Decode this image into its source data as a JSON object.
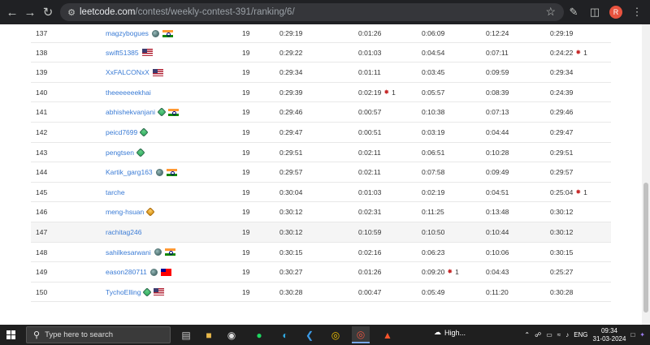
{
  "browser": {
    "url_host": "leetcode.com",
    "url_path": "/contest/weekly-contest-391/ranking/6/",
    "profile_initial": "R"
  },
  "ranking": [
    {
      "rank": "137",
      "user": "magzybogues",
      "badge": "guardian",
      "flag": "in",
      "score": "19",
      "finish": "0:29:19",
      "q1": "0:01:26",
      "q1_wrong": "",
      "q2": "0:06:09",
      "q2_wrong": "",
      "q3": "0:12:24",
      "q4": "0:29:19",
      "q4_wrong": ""
    },
    {
      "rank": "138",
      "user": "swift51385",
      "badge": "",
      "flag": "us",
      "score": "19",
      "finish": "0:29:22",
      "q1": "0:01:03",
      "q1_wrong": "",
      "q2": "0:04:54",
      "q2_wrong": "",
      "q3": "0:07:11",
      "q4": "0:24:22",
      "q4_wrong": "1"
    },
    {
      "rank": "139",
      "user": "XxFALCONxX",
      "badge": "",
      "flag": "us",
      "score": "19",
      "finish": "0:29:34",
      "q1": "0:01:11",
      "q1_wrong": "",
      "q2": "0:03:45",
      "q2_wrong": "",
      "q3": "0:09:59",
      "q4": "0:29:34",
      "q4_wrong": ""
    },
    {
      "rank": "140",
      "user": "theeeeeeekhai",
      "badge": "",
      "flag": "",
      "score": "19",
      "finish": "0:29:39",
      "q1": "0:02:19",
      "q1_wrong": "1",
      "q2": "0:05:57",
      "q2_wrong": "",
      "q3": "0:08:39",
      "q4": "0:24:39",
      "q4_wrong": ""
    },
    {
      "rank": "141",
      "user": "abhishekvanjani",
      "badge": "knight",
      "flag": "in",
      "score": "19",
      "finish": "0:29:46",
      "q1": "0:00:57",
      "q1_wrong": "",
      "q2": "0:10:38",
      "q2_wrong": "",
      "q3": "0:07:13",
      "q4": "0:29:46",
      "q4_wrong": ""
    },
    {
      "rank": "142",
      "user": "peicd7699",
      "badge": "knight",
      "flag": "",
      "score": "19",
      "finish": "0:29:47",
      "q1": "0:00:51",
      "q1_wrong": "",
      "q2": "0:03:19",
      "q2_wrong": "",
      "q3": "0:04:44",
      "q4": "0:29:47",
      "q4_wrong": ""
    },
    {
      "rank": "143",
      "user": "pengtsen",
      "badge": "knight",
      "flag": "",
      "score": "19",
      "finish": "0:29:51",
      "q1": "0:02:11",
      "q1_wrong": "",
      "q2": "0:06:51",
      "q2_wrong": "",
      "q3": "0:10:28",
      "q4": "0:29:51",
      "q4_wrong": ""
    },
    {
      "rank": "144",
      "user": "Kartik_garg163",
      "badge": "guardian",
      "flag": "in",
      "score": "19",
      "finish": "0:29:57",
      "q1": "0:02:11",
      "q1_wrong": "",
      "q2": "0:07:58",
      "q2_wrong": "",
      "q3": "0:09:49",
      "q4": "0:29:57",
      "q4_wrong": ""
    },
    {
      "rank": "145",
      "user": "tarche",
      "badge": "",
      "flag": "",
      "score": "19",
      "finish": "0:30:04",
      "q1": "0:01:03",
      "q1_wrong": "",
      "q2": "0:02:19",
      "q2_wrong": "",
      "q3": "0:04:51",
      "q4": "0:25:04",
      "q4_wrong": "1"
    },
    {
      "rank": "146",
      "user": "meng-hsuan",
      "badge": "gold",
      "flag": "",
      "score": "19",
      "finish": "0:30:12",
      "q1": "0:02:31",
      "q1_wrong": "",
      "q2": "0:11:25",
      "q2_wrong": "",
      "q3": "0:13:48",
      "q4": "0:30:12",
      "q4_wrong": ""
    },
    {
      "rank": "147",
      "user": "rachitag246",
      "badge": "",
      "flag": "",
      "score": "19",
      "finish": "0:30:12",
      "q1": "0:10:59",
      "q1_wrong": "",
      "q2": "0:10:50",
      "q2_wrong": "",
      "q3": "0:10:44",
      "q4": "0:30:12",
      "q4_wrong": ""
    },
    {
      "rank": "148",
      "user": "sahilkesarwani",
      "badge": "guardian",
      "flag": "in",
      "score": "19",
      "finish": "0:30:15",
      "q1": "0:02:16",
      "q1_wrong": "",
      "q2": "0:06:23",
      "q2_wrong": "",
      "q3": "0:10:06",
      "q4": "0:30:15",
      "q4_wrong": ""
    },
    {
      "rank": "149",
      "user": "eason280711",
      "badge": "guardian",
      "flag": "tw",
      "score": "19",
      "finish": "0:30:27",
      "q1": "0:01:26",
      "q1_wrong": "",
      "q2": "0:09:20",
      "q2_wrong": "1",
      "q3": "0:04:43",
      "q4": "0:25:27",
      "q4_wrong": ""
    },
    {
      "rank": "150",
      "user": "TychoElling",
      "badge": "knight",
      "flag": "us",
      "score": "19",
      "finish": "0:30:28",
      "q1": "0:00:47",
      "q1_wrong": "",
      "q2": "0:05:49",
      "q2_wrong": "",
      "q3": "0:11:20",
      "q4": "0:30:28",
      "q4_wrong": ""
    }
  ],
  "taskbar": {
    "search_placeholder": "Type here to search",
    "weather": "High...",
    "language": "ENG",
    "time": "09:34",
    "date": "31-03-2024"
  }
}
